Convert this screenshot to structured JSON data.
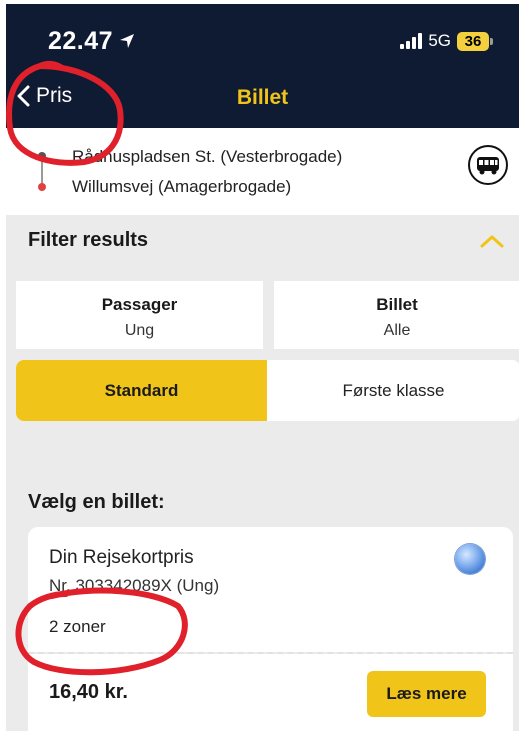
{
  "status_bar": {
    "time": "22.47",
    "network": "5G",
    "battery": "36"
  },
  "nav": {
    "back_label": "Pris",
    "title": "Billet"
  },
  "route": {
    "from": "Rådhuspladsen St. (Vesterbrogade)",
    "to": "Willumsvej (Amagerbrogade)"
  },
  "filter": {
    "title": "Filter results",
    "passenger_label": "Passager",
    "passenger_value": "Ung",
    "ticket_label": "Billet",
    "ticket_value": "Alle",
    "class_options": [
      "Standard",
      "Første klasse"
    ],
    "selected_class": "Standard"
  },
  "tickets": {
    "section_title": "Vælg en billet:",
    "items": [
      {
        "name": "Din Rejsekortpris",
        "card": "Nr. 303342089X (Ung)",
        "zones": "2 zoner",
        "price": "16,40  kr.",
        "button": "Læs mere"
      }
    ]
  },
  "colors": {
    "header_bg": "#0e1b33",
    "accent": "#f0c419",
    "page_bg": "#ebebeb",
    "annotation": "#e0202a"
  },
  "icons": [
    "location-arrow-icon",
    "signal-icon",
    "battery-icon",
    "chevron-left-icon",
    "bus-icon",
    "chevron-up-icon",
    "radio-selected-icon"
  ]
}
